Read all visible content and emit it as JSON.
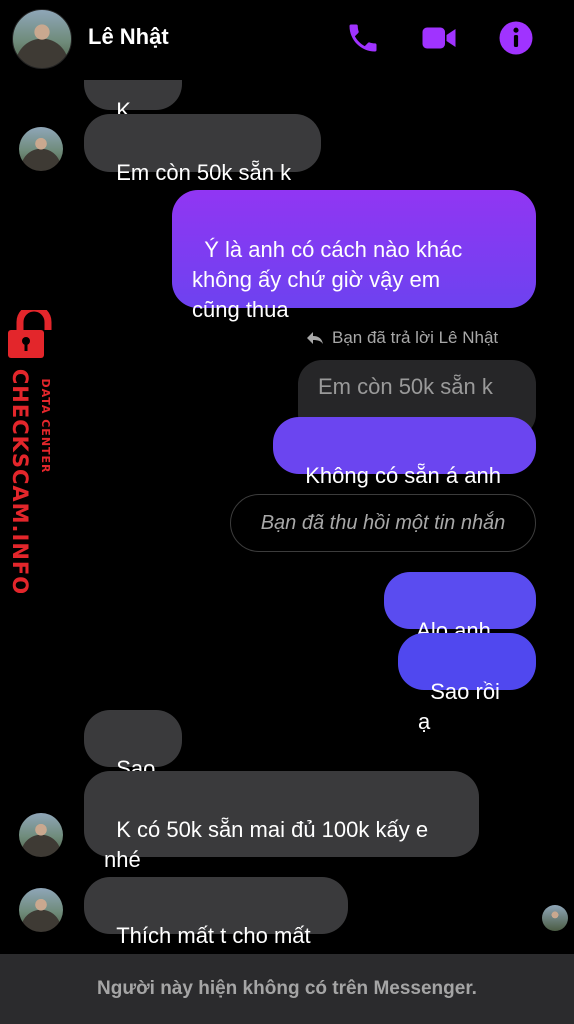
{
  "header": {
    "contact_name": "Lê Nhật",
    "accent_color": "#a033ff",
    "icons": [
      "phone-icon",
      "video-icon",
      "info-icon"
    ]
  },
  "messages": [
    {
      "id": "partial",
      "direction": "incoming",
      "text": "K sao"
    },
    {
      "id": "m1",
      "direction": "incoming",
      "text": "Em còn 50k sẵn k"
    },
    {
      "id": "m2",
      "direction": "outgoing",
      "text": "Ý là anh có cách nào khác\nkhông ấy chứ giờ vậy em\ncũng thua"
    },
    {
      "id": "m3",
      "direction": "outgoing",
      "text": "Không có sẵn á anh",
      "reply_note": "Bạn đã trả lời Lê Nhật",
      "quoted": "Em còn 50k sẵn k"
    },
    {
      "id": "m4",
      "direction": "outgoing",
      "text": "Bạn đã thu hồi một tin nhắn",
      "recalled": true
    },
    {
      "id": "m5",
      "direction": "outgoing",
      "text": "Alo anh ơi"
    },
    {
      "id": "m6",
      "direction": "outgoing",
      "text": "Sao rồi ạ"
    },
    {
      "id": "m7",
      "direction": "incoming",
      "text": "Sao ý"
    },
    {
      "id": "m8",
      "direction": "incoming",
      "text": "K có 50k sẵn mai đủ 100k kấy e\nnhé"
    },
    {
      "id": "m9",
      "direction": "incoming",
      "text": "Thích mất t cho mất"
    }
  ],
  "footer": {
    "notice": "Người này hiện không có trên Messenger."
  },
  "watermark": {
    "site": "CHECKSCAM.INFO",
    "tag": "DATA CENTER",
    "color": "#e3262b",
    "icon": "padlock-icon"
  }
}
